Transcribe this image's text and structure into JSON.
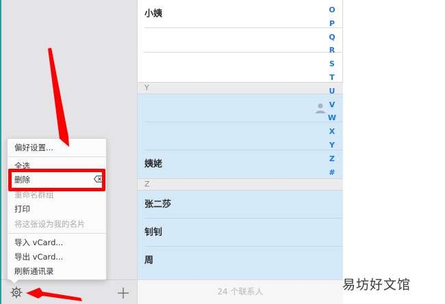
{
  "contacts": [
    {
      "name": "小姨",
      "selected": false
    },
    {
      "name": "",
      "selected": false
    },
    {
      "name": "",
      "selected": false
    },
    {
      "section": "Y"
    },
    {
      "name": "",
      "selected": true,
      "avatar": true
    },
    {
      "name": "",
      "selected": true
    },
    {
      "name": "姨姥",
      "selected": true
    },
    {
      "section": "Z"
    },
    {
      "name": "张二莎",
      "selected": true
    },
    {
      "name": "钊钊",
      "selected": true
    },
    {
      "name": "周",
      "selected": true
    }
  ],
  "footer": {
    "count": "24 个联系人"
  },
  "index_letters": [
    "O",
    "P",
    "Q",
    "R",
    "S",
    "T",
    "U",
    "V",
    "W",
    "X",
    "Y",
    "Z",
    "#"
  ],
  "menu": {
    "preferences": "偏好设置...",
    "select_all": "全选",
    "delete": "删除",
    "rename_group": "重命名群组",
    "print": "打印",
    "set_my_card": "将这张设为我的名片",
    "import_vcard": "导入 vCard...",
    "export_vcard": "导出 vCard...",
    "refresh": "刷新通讯录"
  },
  "icons": {
    "settings": "gear-icon",
    "add": "plus-icon",
    "avatar": "person-icon",
    "delete": "delete-key-icon"
  },
  "watermark": "易坊好文馆",
  "colors": {
    "selection": "#d4e9f8",
    "index": "#1f78e0",
    "annotation": "#ff0000"
  }
}
